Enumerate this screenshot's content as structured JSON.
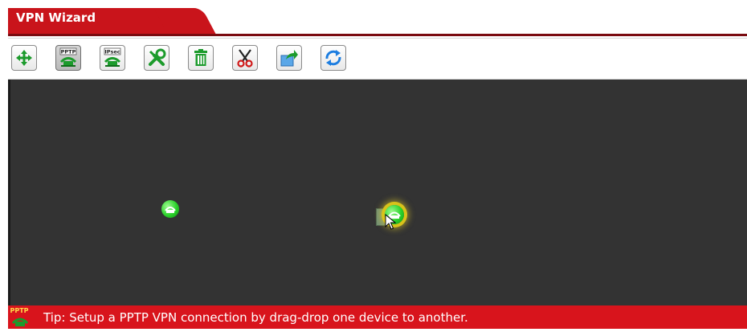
{
  "window": {
    "title": "VPN Wizard"
  },
  "toolbar": {
    "buttons": [
      {
        "name": "move",
        "icon": "move-arrows-icon",
        "label": ""
      },
      {
        "name": "pptp",
        "icon": "pptp-tunnel-icon",
        "label": "PPTP",
        "active": true
      },
      {
        "name": "ipsec",
        "icon": "ipsec-tunnel-icon",
        "label": "IPsec"
      },
      {
        "name": "configure",
        "icon": "tools-icon",
        "label": ""
      },
      {
        "name": "delete",
        "icon": "trash-icon",
        "label": ""
      },
      {
        "name": "cut",
        "icon": "scissors-icon",
        "label": ""
      },
      {
        "name": "export",
        "icon": "export-arrow-icon",
        "label": ""
      },
      {
        "name": "refresh",
        "icon": "refresh-icon",
        "label": ""
      }
    ]
  },
  "canvas": {
    "background": "#333333",
    "nodes": [
      {
        "name": "router-node-1",
        "icon": "router-icon",
        "state": "normal"
      },
      {
        "name": "router-node-2",
        "icon": "router-icon",
        "state": "highlighted"
      }
    ]
  },
  "tip": {
    "icon_label": "PPTP",
    "text": "Tip: Setup a PPTP VPN connection by drag-drop one device to another."
  },
  "colors": {
    "accent": "#c9141b",
    "tip_bar": "#d8141c",
    "icon_green": "#1c9b2c",
    "node_green": "#2bd12b",
    "highlight": "#d9c21a"
  }
}
